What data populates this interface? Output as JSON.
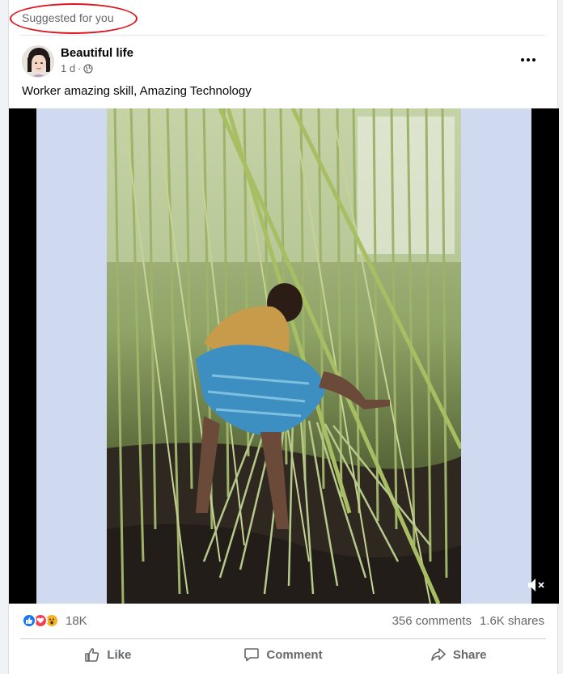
{
  "post": {
    "suggested_label": "Suggested for you",
    "page_name": "Beautiful life",
    "time": "1 d",
    "meta_separator": "·",
    "privacy_icon": "globe-icon",
    "caption": "Worker amazing skill, Amazing Technology",
    "annotation_color": "#e0141e"
  },
  "engagement": {
    "reaction_icons": [
      "like-icon",
      "love-icon",
      "wow-icon"
    ],
    "reaction_count": "18K",
    "comments": "356 comments",
    "shares": "1.6K shares"
  },
  "actions": {
    "like_label": "Like",
    "comment_label": "Comment",
    "share_label": "Share"
  },
  "colors": {
    "like_blue": "#1877f2",
    "love_red": "#f33e58",
    "wow_yellow": "#f7b125",
    "muted_text": "#65676b"
  }
}
